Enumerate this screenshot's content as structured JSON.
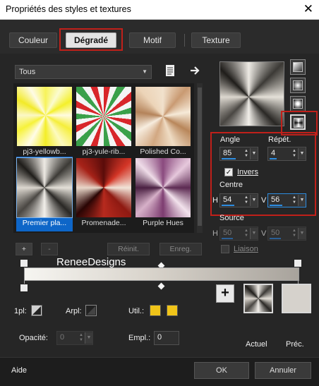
{
  "window": {
    "title": "Propriétés des styles et textures",
    "close": "✕"
  },
  "tabs": [
    {
      "label": "Couleur"
    },
    {
      "label": "Dégradé"
    },
    {
      "label": "Motif"
    },
    {
      "label": "Texture"
    }
  ],
  "library": {
    "filter_value": "Tous",
    "items": [
      {
        "label": "pj3-yellowb..."
      },
      {
        "label": "pj3-yule-rib..."
      },
      {
        "label": "Polished Co..."
      },
      {
        "label": "Premier pla..."
      },
      {
        "label": "Promenade..."
      },
      {
        "label": "Purple Hues"
      }
    ],
    "selected_index": 3
  },
  "library_buttons": {
    "add": "+",
    "remove": "-",
    "reset": "Réinit.",
    "save": "Enreg."
  },
  "editor": {
    "watermark": "ReneeDesigns"
  },
  "params": {
    "angle_label": "Angle",
    "angle_value": "85",
    "repeat_label": "Répét.",
    "repeat_value": "4",
    "invert_label": "Invers",
    "invert_checked": true,
    "center_label": "Centre",
    "center_h_label": "H",
    "center_h_value": "54",
    "center_v_label": "V",
    "center_v_value": "56",
    "source_label": "Source",
    "source_h_label": "H",
    "source_h_value": "50",
    "source_v_label": "V",
    "source_v_value": "50",
    "link_label": "Liaison"
  },
  "stop_settings": {
    "fill_label": "1pl:",
    "arpl_label": "Arpl:",
    "util_label": "Util.:",
    "opacity_label": "Opacité:",
    "opacity_value": "0",
    "empl_label": "Empl.:",
    "empl_value": "0",
    "util_colors": [
      "#f0c419",
      "#f0c419"
    ]
  },
  "compare": {
    "add": "+",
    "current_label": "Actuel",
    "previous_label": "Préc."
  },
  "footer": {
    "help": "Aide",
    "ok": "OK",
    "cancel": "Annuler"
  },
  "colors": {
    "highlight": "#c0201a",
    "selection": "#0e66c8",
    "accent": "#2d8de0"
  }
}
